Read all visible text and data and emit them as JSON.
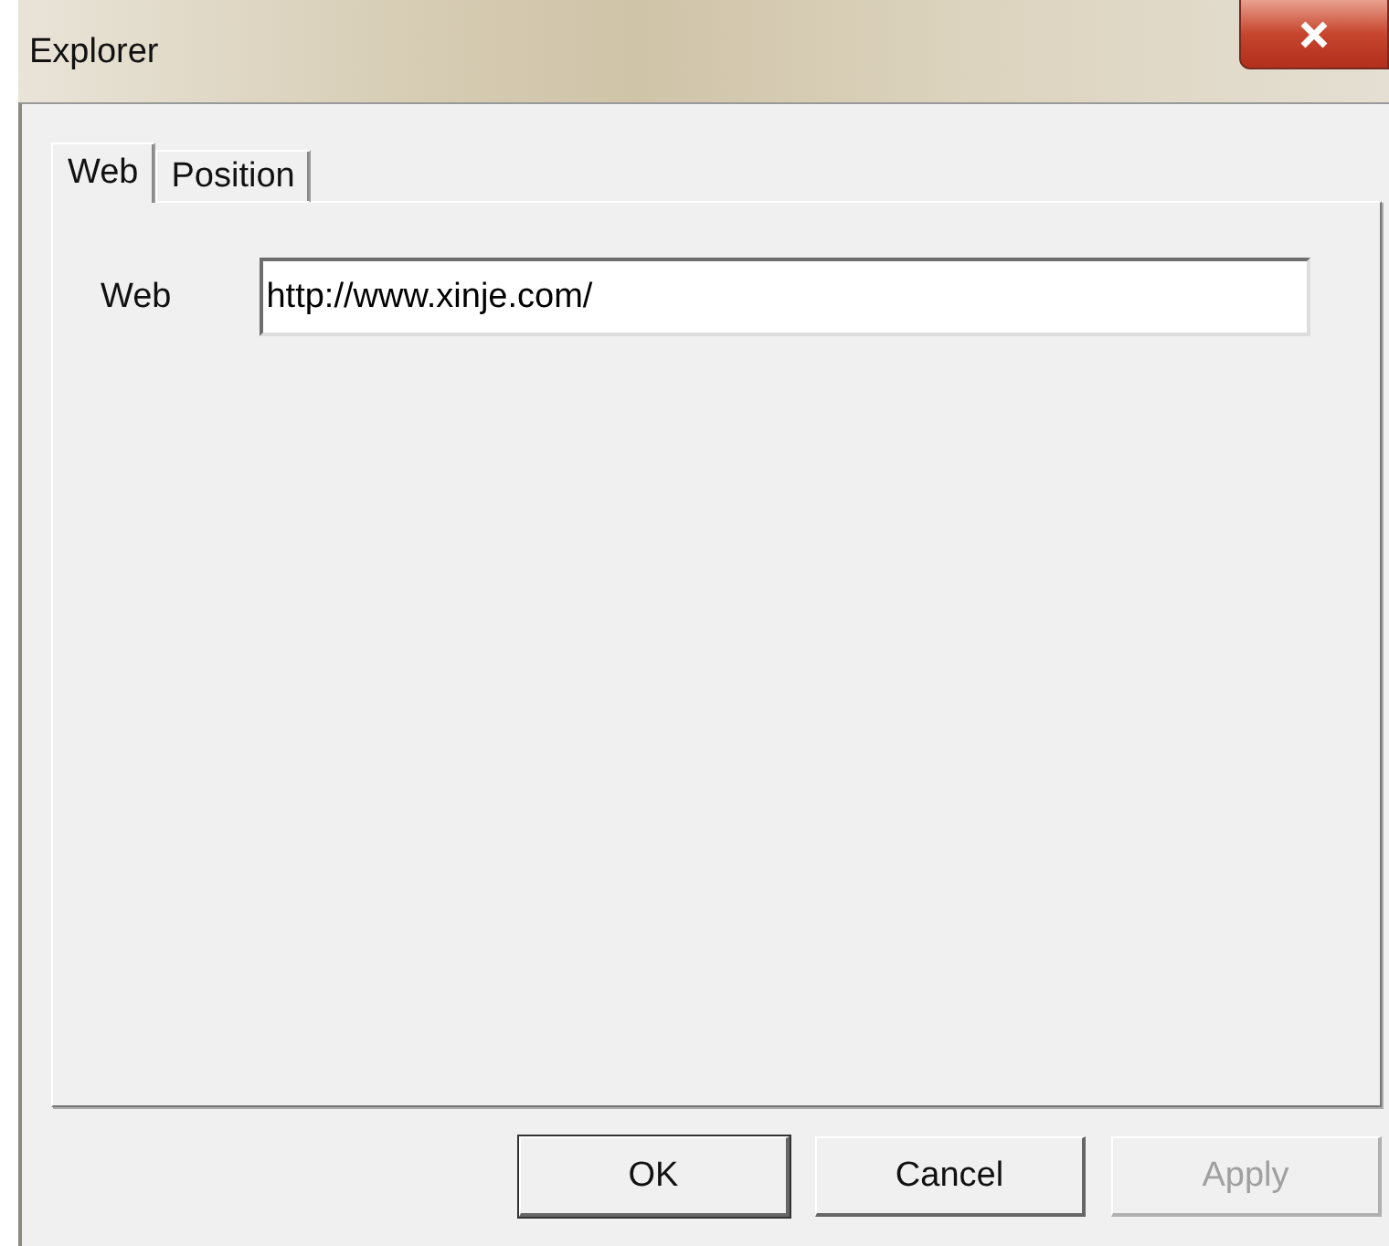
{
  "window": {
    "title": "Explorer"
  },
  "tabs": [
    {
      "label": "Web",
      "selected": true
    },
    {
      "label": "Position",
      "selected": false
    }
  ],
  "field": {
    "label": "Web",
    "value": "http://www.xinje.com/"
  },
  "buttons": [
    {
      "label": "OK",
      "disabled": false
    },
    {
      "label": "Cancel",
      "disabled": false
    },
    {
      "label": "Apply",
      "disabled": true
    }
  ]
}
